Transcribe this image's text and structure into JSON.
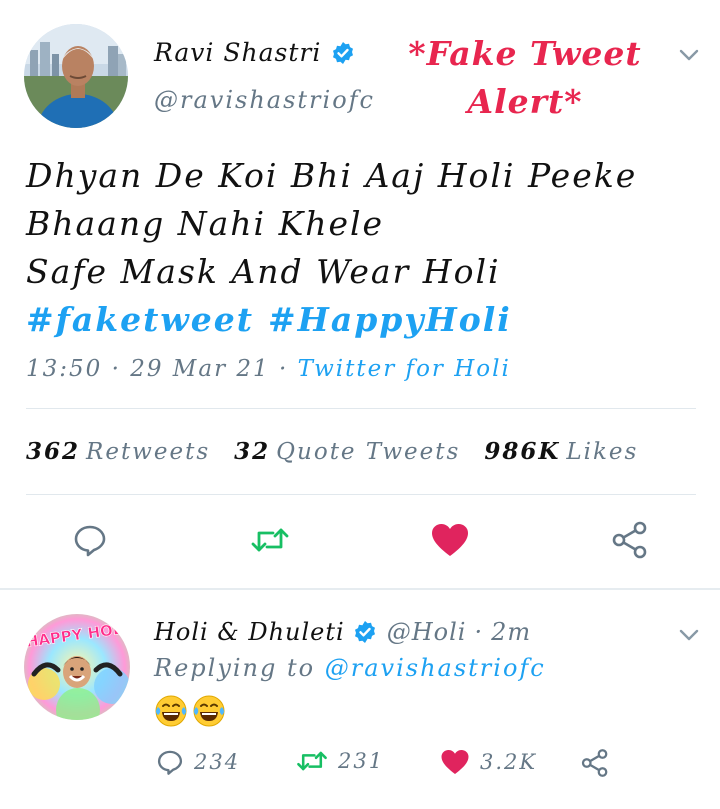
{
  "tweet": {
    "author": {
      "name": "Ravi Shastri",
      "handle": "@ravishastriofc"
    },
    "overlay_label": "*Fake Tweet Alert*",
    "lines": [
      "Dhyan De Koi Bhi Aaj Holi Peeke",
      "Bhaang Nahi Khele",
      "Safe Mask And Wear Holi"
    ],
    "hashtags": [
      "#faketweet",
      "#HappyHoli"
    ],
    "time": "13:50",
    "date": "29 Mar 21",
    "separator": "·",
    "source": "Twitter for Holi",
    "stats": {
      "retweets_count": "362",
      "retweets_label": "Retweets",
      "quotes_count": "32",
      "quotes_label": "Quote Tweets",
      "likes_count": "986K",
      "likes_label": "Likes"
    },
    "actions": [
      {
        "icon": "reply-icon"
      },
      {
        "icon": "retweet-icon"
      },
      {
        "icon": "like-icon-filled"
      },
      {
        "icon": "share-icon"
      }
    ]
  },
  "reply": {
    "author": {
      "name": "Holi & Dhuleti",
      "handle": "@Holi",
      "time": "2m",
      "separator": "·"
    },
    "replying_prefix": "Replying to",
    "replying_to": "@ravishastriofc",
    "avatar_text": "HAPPY HOLI",
    "emojis": [
      "face-with-tears-of-joy",
      "face-with-tears-of-joy"
    ],
    "counts": {
      "replies": "234",
      "retweets": "231",
      "likes": "3.2K"
    }
  },
  "colors": {
    "accent": "#1da1f2",
    "retweet": "#17bf63",
    "like": "#e0245e",
    "alert": "#e8264f",
    "muted": "#657786"
  }
}
